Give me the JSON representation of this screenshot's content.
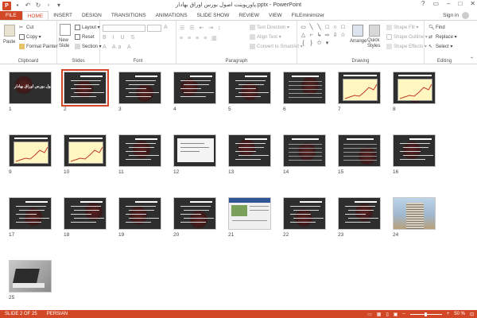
{
  "app": {
    "window_title": "پاورپوینت اصول بورس اوراق بهادار.pptx - PowerPoint",
    "app_icon_letter": "P",
    "sign_in": "Sign in",
    "window_controls": [
      "?",
      "▭",
      "–",
      "□",
      "✕"
    ]
  },
  "tabs": [
    {
      "label": "FILE"
    },
    {
      "label": "HOME"
    },
    {
      "label": "INSERT"
    },
    {
      "label": "DESIGN"
    },
    {
      "label": "TRANSITIONS"
    },
    {
      "label": "ANIMATIONS"
    },
    {
      "label": "SLIDE SHOW"
    },
    {
      "label": "REVIEW"
    },
    {
      "label": "VIEW"
    },
    {
      "label": "FILEminimizer"
    }
  ],
  "ribbon": {
    "clipboard": {
      "label": "Clipboard",
      "paste": "Paste",
      "cut": "Cut",
      "copy": "Copy",
      "format_painter": "Format Painter"
    },
    "slides": {
      "label": "Slides",
      "new_slide": "New Slide",
      "layout": "Layout",
      "reset": "Reset",
      "section": "Section"
    },
    "font": {
      "label": "Font"
    },
    "paragraph": {
      "label": "Paragraph",
      "text_direction": "Text Direction",
      "align_text": "Align Text",
      "convert_smartart": "Convert to SmartArt"
    },
    "drawing": {
      "label": "Drawing",
      "arrange": "Arrange",
      "quick_styles": "Quick Styles",
      "shape_fill": "Shape Fill",
      "shape_outline": "Shape Outline",
      "shape_effects": "Shape Effects"
    },
    "editing": {
      "label": "Editing",
      "find": "Find",
      "replace": "Replace",
      "select": "Select"
    }
  },
  "slides": [
    {
      "num": "1"
    },
    {
      "num": "2"
    },
    {
      "num": "3"
    },
    {
      "num": "4"
    },
    {
      "num": "5"
    },
    {
      "num": "6"
    },
    {
      "num": "7"
    },
    {
      "num": "8"
    },
    {
      "num": "9"
    },
    {
      "num": "10"
    },
    {
      "num": "11"
    },
    {
      "num": "12"
    },
    {
      "num": "13"
    },
    {
      "num": "14"
    },
    {
      "num": "15"
    },
    {
      "num": "16"
    },
    {
      "num": "17"
    },
    {
      "num": "18"
    },
    {
      "num": "19"
    },
    {
      "num": "20"
    },
    {
      "num": "21"
    },
    {
      "num": "22"
    },
    {
      "num": "23"
    },
    {
      "num": "24"
    },
    {
      "num": "25"
    }
  ],
  "slide1_title": "اصول بورس اوراق بهادار",
  "selected_slide": "2",
  "status": {
    "slide_info": "SLIDE 2 OF 25",
    "language": "PERSIAN",
    "zoom": "50 %"
  },
  "colors": {
    "accent": "#d24726"
  }
}
